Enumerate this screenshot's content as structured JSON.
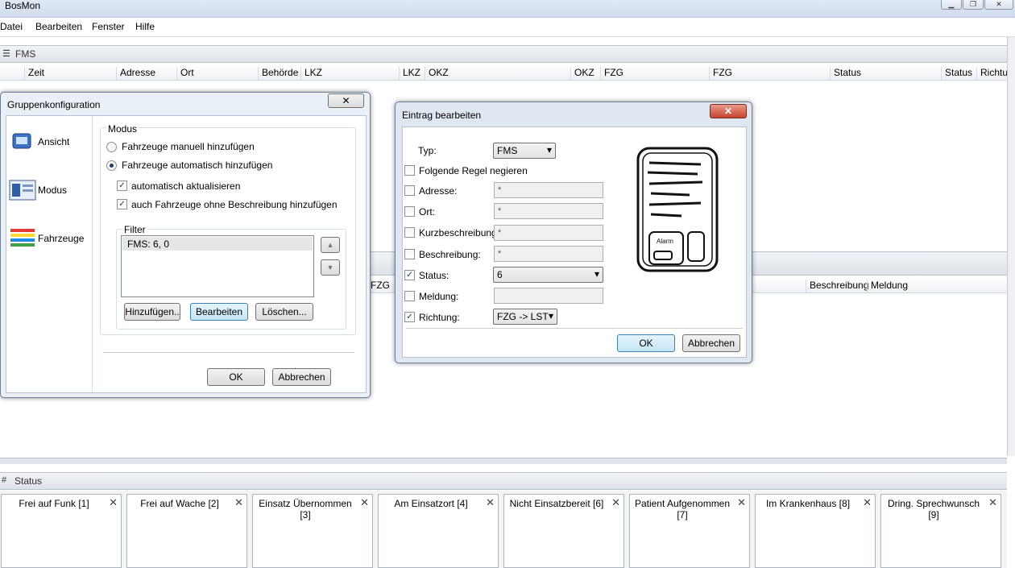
{
  "app": {
    "title": "BosMon",
    "win_min": "▁",
    "win_max": "❐",
    "win_close": "✕"
  },
  "menu": [
    "Datei",
    "Bearbeiten",
    "Fenster",
    "Hilfe"
  ],
  "fms_panel": {
    "title": "FMS",
    "columns": [
      "Zeit",
      "Adresse",
      "Ort",
      "Behörde",
      "LKZ",
      "LKZ",
      "OKZ",
      "OKZ",
      "FZG",
      "FZG",
      "Status",
      "Status",
      "Richtun"
    ]
  },
  "second_panel": {
    "columns": [
      "FZG",
      "Beschreibung",
      "Meldung"
    ]
  },
  "status_panel": {
    "title": "Status",
    "cards": [
      "Frei auf Funk [1]",
      "Frei auf Wache [2]",
      "Einsatz Übernommen [3]",
      "Am Einsatzort [4]",
      "Nicht Einsatzbereit [6]",
      "Patient Aufgenommen [7]",
      "Im Krankenhaus [8]",
      "Dring. Sprechwunsch [9]"
    ],
    "close": "✕"
  },
  "gruppen": {
    "title": "Gruppenkonfiguration",
    "close": "✕",
    "nav": [
      "Ansicht",
      "Modus",
      "Fahrzeuge"
    ],
    "modus_label": "Modus",
    "radio_manual": "Fahrzeuge manuell hinzufügen",
    "radio_auto": "Fahrzeuge automatisch hinzufügen",
    "cb_update": "automatisch aktualisieren",
    "cb_nodesc": "auch Fahrzeuge ohne Beschreibung hinzufügen",
    "filter_label": "Filter",
    "filter_items": [
      "FMS: 6, 0"
    ],
    "btn_add": "Hinzufügen..",
    "btn_edit": "Bearbeiten",
    "btn_delete": "Löschen...",
    "ok": "OK",
    "cancel": "Abbrechen"
  },
  "eintrag": {
    "title": "Eintrag bearbeiten",
    "close": "✕",
    "typ_label": "Typ:",
    "typ_value": "FMS",
    "negate": "Folgende Regel negieren",
    "rows": [
      {
        "label": "Adresse:",
        "value": "*",
        "checked": false
      },
      {
        "label": "Ort:",
        "value": "*",
        "checked": false
      },
      {
        "label": "Kurzbeschreibung:",
        "value": "*",
        "checked": false
      },
      {
        "label": "Beschreibung:",
        "value": "*",
        "checked": false
      }
    ],
    "status_label": "Status:",
    "status_value": "6",
    "meldung_label": "Meldung:",
    "meldung_value": "",
    "richtung_label": "Richtung:",
    "richtung_value": "FZG -> LST",
    "device_text": "Alarm",
    "ok": "OK",
    "cancel": "Abbrechen"
  }
}
